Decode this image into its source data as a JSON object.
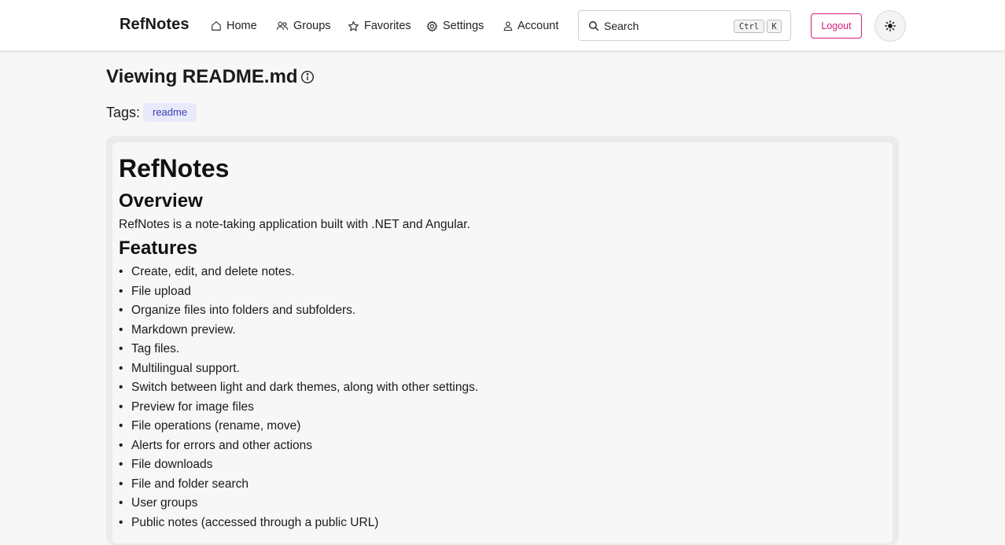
{
  "app": {
    "brand": "RefNotes"
  },
  "nav": {
    "items": [
      {
        "label": "Home",
        "icon": "home-icon"
      },
      {
        "label": "Groups",
        "icon": "users-icon"
      },
      {
        "label": "Favorites",
        "icon": "star-icon"
      },
      {
        "label": "Settings",
        "icon": "gear-icon"
      },
      {
        "label": "Account",
        "icon": "user-icon"
      }
    ],
    "search": {
      "label": "Search",
      "shortcut_keys": [
        "Ctrl",
        "K"
      ]
    },
    "logout_label": "Logout",
    "theme_toggle_icon": "sun-icon"
  },
  "page": {
    "title": "Viewing README.md",
    "tags_label": "Tags:",
    "tags": [
      "readme"
    ]
  },
  "markdown": {
    "h1": "RefNotes",
    "overview_heading": "Overview",
    "overview_text": "RefNotes is a note-taking application built with .NET and Angular.",
    "features_heading": "Features",
    "features": [
      "Create, edit, and delete notes.",
      "File upload",
      "Organize files into folders and subfolders.",
      "Markdown preview.",
      "Tag files.",
      "Multilingual support.",
      "Switch between light and dark themes, along with other settings.",
      "Preview for image files",
      "File operations (rename, move)",
      "Alerts for errors and other actions",
      "File downloads",
      "File and folder search",
      "User groups",
      "Public notes (accessed through a public URL)"
    ]
  },
  "colors": {
    "accent_logout": "#d21f7a",
    "tag_bg": "#e8e9fb",
    "tag_text": "#3a3fb0",
    "page_bg": "#f7f7f7"
  }
}
